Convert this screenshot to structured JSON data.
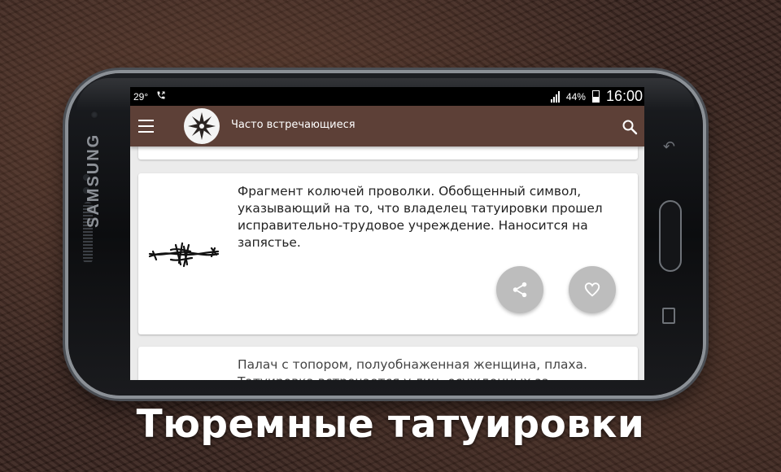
{
  "status_bar": {
    "temperature": "29°",
    "battery_percent": "44%",
    "time": "16:00"
  },
  "app_bar": {
    "title": "Часто встречающиеся"
  },
  "icons": {
    "menu": "menu-icon",
    "search": "search-icon",
    "share": "share-icon",
    "like": "heart-icon",
    "call": "phone-icon",
    "signal": "signal-icon",
    "battery": "battery-icon"
  },
  "cards": [
    {
      "image": "barbed-wire",
      "text": "Фрагмент колючей проволки. Обобщенный символ, указывающий на то, что владелец татуировки прошел исправительно-трудовое учреждение. Наносится на запястье."
    },
    {
      "text": "Палач с топором, полуобнаженная женщина, плаха. Татуировка встречается у лиц, осужденных за"
    }
  ],
  "caption": "Тюремные татуировки",
  "colors": {
    "app_bar": "#5d4037",
    "fab": "#bdbdbd",
    "screen_bg": "#ebebeb"
  }
}
